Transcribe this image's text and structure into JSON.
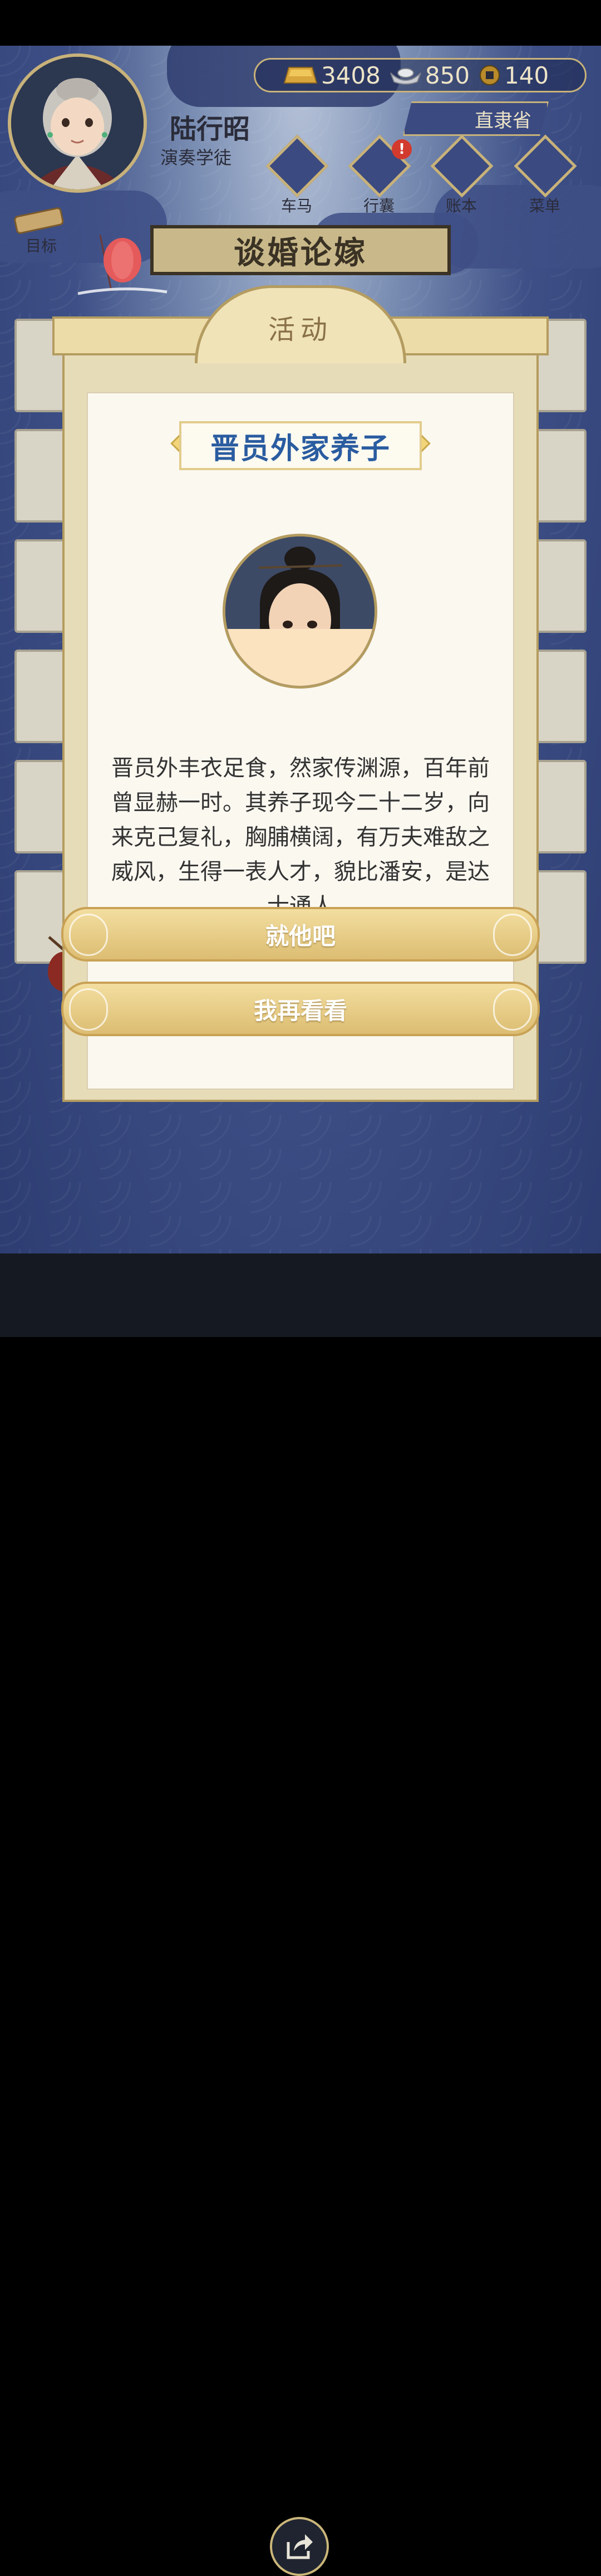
{
  "header": {
    "player_name": "陆行昭",
    "player_title": "演奏学徒",
    "province": "直隶省"
  },
  "currency": [
    {
      "icon": "gold-bar-icon",
      "value": "3408"
    },
    {
      "icon": "silver-ingot-icon",
      "value": "850"
    },
    {
      "icon": "copper-coin-icon",
      "value": "140"
    }
  ],
  "nav": [
    {
      "label": "车马",
      "icon": "carriage-icon"
    },
    {
      "label": "行囊",
      "icon": "bag-icon",
      "badge": "!"
    },
    {
      "label": "账本",
      "icon": "ledger-icon"
    },
    {
      "label": "菜单",
      "icon": "menu-dots-icon"
    }
  ],
  "goal_label": "目标",
  "page_title": "谈婚论嫁",
  "modal": {
    "header": "活动",
    "candidate_name": "晋员外家养子",
    "description": "晋员外丰衣足食，然家传渊源，百年前曾显赫一时。其养子现今二十二岁，向来克己复礼，胸脯横阔，有万夫难敌之威风，生得一表人才，貌比潘安，是达士通人",
    "confirm_label": "就他吧",
    "cancel_label": "我再看看"
  },
  "colors": {
    "accent_gold": "#c8b27a",
    "title_blue": "#2a5ca0",
    "background_blue": "#2d3d72"
  }
}
